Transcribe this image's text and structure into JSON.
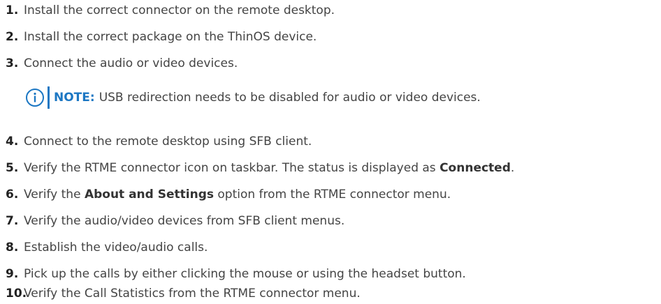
{
  "steps": [
    {
      "num": "1.",
      "text": "Install the correct connector on the remote desktop."
    },
    {
      "num": "2.",
      "text": "Install the correct package on the ThinOS device."
    },
    {
      "num": "3.",
      "text": "Connect the audio or video devices."
    },
    {
      "num": "4.",
      "text": "Connect to the remote desktop using SFB client."
    },
    {
      "num": "5.",
      "text_before": "Verify the RTME connector icon on taskbar. The status is displayed as ",
      "bold": "Connected",
      "text_after": "."
    },
    {
      "num": "6.",
      "text_before": "Verify the ",
      "bold": "About and Settings",
      "text_after": " option from the RTME connector menu."
    },
    {
      "num": "7.",
      "text": "Verify the audio/video devices from SFB client menus."
    },
    {
      "num": "8.",
      "text": "Establish the video/audio calls."
    },
    {
      "num": "9.",
      "text": "Pick up the calls by either clicking the mouse or using the headset button."
    },
    {
      "num": "10.",
      "text": "Verify the Call Statistics from the RTME connector menu."
    }
  ],
  "note": {
    "icon": "info-icon",
    "label": "NOTE:",
    "text": "USB redirection needs to be disabled for audio or video devices."
  },
  "colors": {
    "accent": "#1c77c3",
    "text": "#444444"
  }
}
